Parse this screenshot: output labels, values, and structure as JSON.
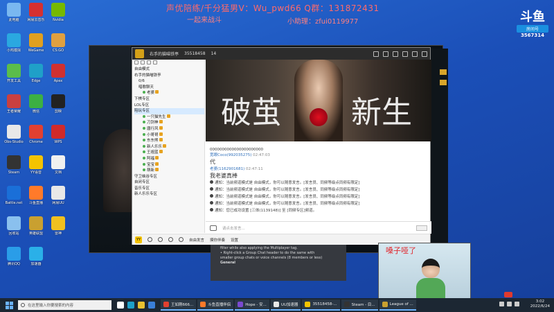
{
  "desktop_icons": [
    {
      "label": "此电脑",
      "color": "#7ab8f0"
    },
    {
      "label": "小鸡模拟",
      "color": "#2aa8e0"
    },
    {
      "label": "开发工具",
      "color": "#5bbd4a"
    },
    {
      "label": "王者荣耀",
      "color": "#c94040"
    },
    {
      "label": "Obs-Studio",
      "color": "#e8e8e8"
    },
    {
      "label": "Steam",
      "color": "#333333"
    },
    {
      "label": "Battle.net",
      "color": "#1a6fd8"
    },
    {
      "label": "回收站",
      "color": "#8ac0ee"
    },
    {
      "label": "腾讯QQ",
      "color": "#2a9de8"
    },
    {
      "label": "网易云音乐",
      "color": "#d63030"
    },
    {
      "label": "WeGame",
      "color": "#e0a020"
    },
    {
      "label": "Edge",
      "color": "#1fa0c8"
    },
    {
      "label": "微信",
      "color": "#3cb043"
    },
    {
      "label": "Chrome",
      "color": "#e24030"
    },
    {
      "label": "YY语音",
      "color": "#f4c300"
    },
    {
      "label": "斗鱼直播",
      "color": "#ff7a2a"
    },
    {
      "label": "英雄联盟",
      "color": "#c9a030"
    },
    {
      "label": "加速器",
      "color": "#2ab0e8"
    },
    {
      "label": "Nvidia",
      "color": "#76b900"
    },
    {
      "label": "CS:GO",
      "color": "#e0a040"
    },
    {
      "label": "Apex",
      "color": "#d03030"
    },
    {
      "label": "剪映",
      "color": "#222222"
    },
    {
      "label": "WPS",
      "color": "#d02a2a"
    },
    {
      "label": "文档",
      "color": "#f0f0f0"
    },
    {
      "label": "网易UU",
      "color": "#e8e8e8"
    },
    {
      "label": "雷神",
      "color": "#f0c020"
    }
  ],
  "overlay": {
    "line1": "声优陪练/千分猛男V：Wu_pwd66  Q群：131872431",
    "line2": "一起来战斗",
    "line3": "小助理：zfui0119977"
  },
  "douyu": {
    "mark": "斗鱼",
    "tag": "房间号",
    "room": "3567314"
  },
  "yy": {
    "channel_title": "右手的猫喵铁亭",
    "channel_id": "35518458",
    "online": "14",
    "tree": [
      {
        "text": "自由模式",
        "level": 0
      },
      {
        "text": "右手的猫喵铁亭",
        "level": 0
      },
      {
        "text": "0/6",
        "level": 1
      },
      {
        "text": "唱歌聊天",
        "level": 1
      },
      {
        "text": "老婆",
        "level": 2
      },
      {
        "text": "下棋专区",
        "level": 0
      },
      {
        "text": "LOL专区",
        "level": 0
      },
      {
        "text": "陪玩专区",
        "level": 0,
        "selected": true
      },
      {
        "text": "一只猫先生",
        "level": 2
      },
      {
        "text": "刀剑神",
        "level": 2
      },
      {
        "text": "唐行风",
        "level": 2
      },
      {
        "text": "小哥哥",
        "level": 2
      },
      {
        "text": "东东熊",
        "level": 2
      },
      {
        "text": "新人乐乐",
        "level": 2
      },
      {
        "text": "王祖蓝",
        "level": 2
      },
      {
        "text": "阿福",
        "level": 2
      },
      {
        "text": "宝宝",
        "level": 2
      },
      {
        "text": "萌新",
        "level": 2
      },
      {
        "text": "守卫峡谷专区",
        "level": 0
      },
      {
        "text": "自闭专区",
        "level": 0
      },
      {
        "text": "音乐专区",
        "level": 0
      },
      {
        "text": "新人乐乐专区",
        "level": 0
      }
    ],
    "banner_left": "破茧",
    "banner_right": "新生",
    "chat": {
      "first_line": "0000000000000000000000",
      "msg1_nick": "宽眼Coco(992035275)",
      "msg1_time": "02:47:03",
      "msg1_text": "代",
      "msg2_nick": "老婆(1162901681)",
      "msg2_time": "02:47:11",
      "msg2_text": "我老婆真棒",
      "notices": [
        "通知：当前频道模式是 自由模式，你可以随意发言。[发言员、同频等级点同频有限定]",
        "通知：当前频道模式是 自由模式，你可以随意发言。[发言员、同频等级点同频有限定]",
        "通知：当前频道模式是 自由模式，你可以随意发言。[发言员、同频等级点同频有限定]",
        "通知：当前频道模式是 自由模式，你可以随意发言。[发言员、同频等级点同频有限定]",
        "通知：您已成功设置 [三体(1139148)] 至 [同频专区]频道。"
      ]
    },
    "input_placeholder": "请点击发言...",
    "bottom": {
      "logo": "YY",
      "mode": "自由发言",
      "mic": "摸你伴奏",
      "settings": "设置"
    }
  },
  "discord": {
    "line1": "filter while also applying the Multiplayer tag.",
    "line2": "• Right-click a Group Chat header to do the same with",
    "line3": "smaller group chats or voice channels (8 members or less)",
    "line4": "General"
  },
  "webcam_caption": "嗓子哑了",
  "taskbar": {
    "search_placeholder": "在这里输入你要搜索的内容",
    "tasks": [
      {
        "label": "王如刚666...",
        "color": "#e24030"
      },
      {
        "label": "斗鱼直播伴侣",
        "color": "#ff7a2a"
      },
      {
        "label": "Hope - 安...",
        "color": "#7a4ad0"
      },
      {
        "label": "UU加速器",
        "color": "#e8e8e8"
      },
      {
        "label": "35518458-...",
        "color": "#f4c300"
      },
      {
        "label": "Steam - 目...",
        "color": "#333333"
      },
      {
        "label": "League of ...",
        "color": "#c9a030"
      }
    ],
    "time": "3:02",
    "date": "2022/6/24"
  }
}
